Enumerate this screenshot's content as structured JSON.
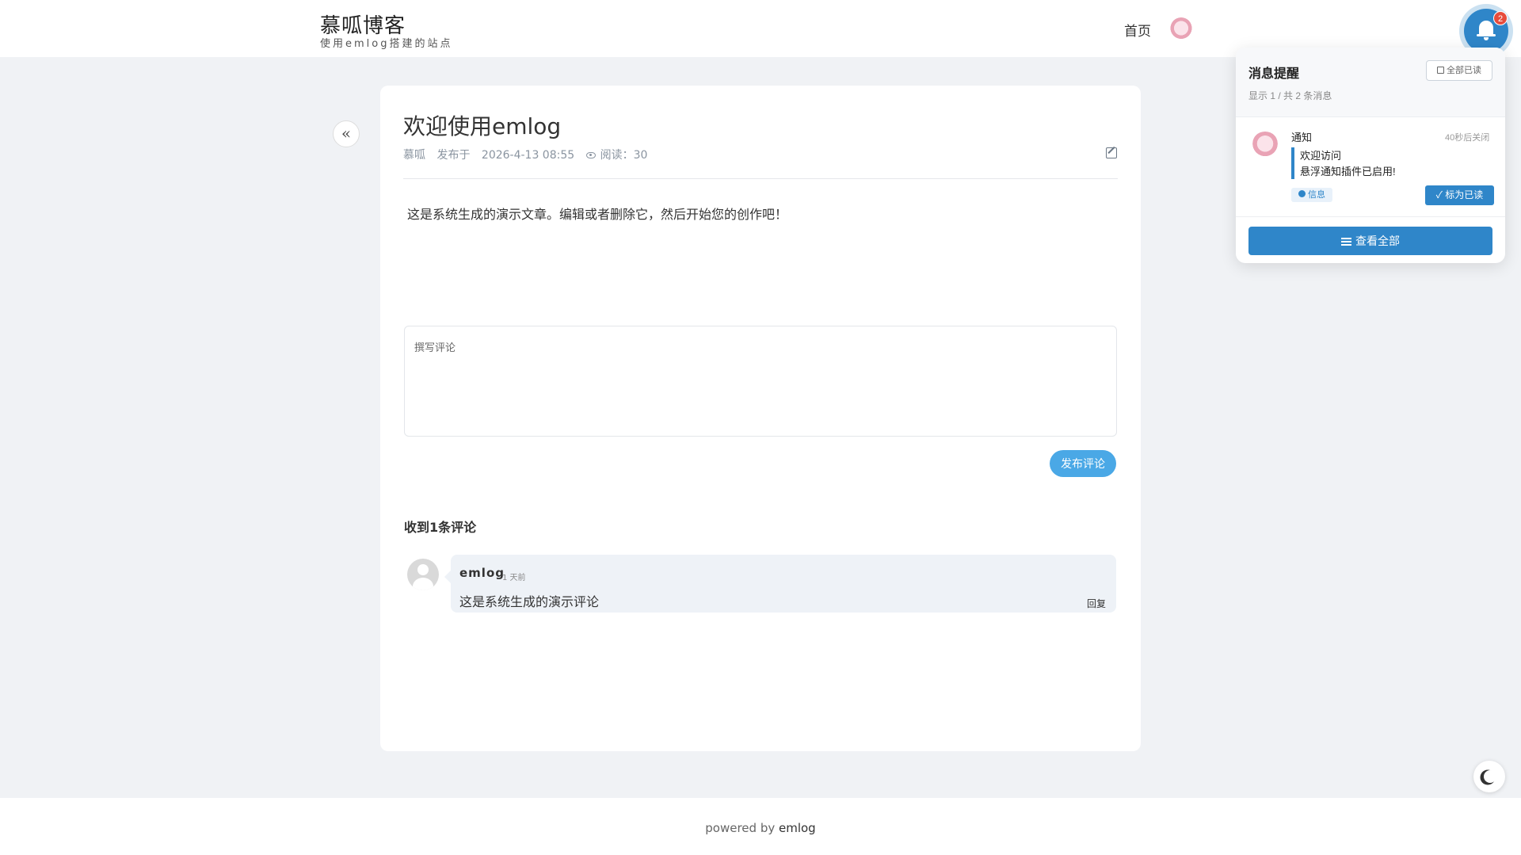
{
  "header": {
    "site_title": "慕呱博客",
    "site_subtitle": "使用emlog搭建的站点",
    "nav_home": "首页"
  },
  "post": {
    "back_glyph": "«",
    "title": "欢迎使用emlog",
    "author": "慕呱",
    "published_label": "发布于",
    "published_at": "2026-4-13 08:55",
    "views_label": "阅读：30",
    "body": "这是系统生成的演示文章。编辑或者删除它，然后开始您的创作吧！"
  },
  "comment_form": {
    "placeholder": "撰写评论",
    "submit_label": "发布评论"
  },
  "comments": {
    "heading": "收到1条评论",
    "items": [
      {
        "author": "emlog",
        "time": "1 天前",
        "text": "这是系统生成的演示评论",
        "reply_label": "回复"
      }
    ]
  },
  "footer": {
    "prefix": "powered by",
    "brand": "emlog"
  },
  "notifications": {
    "badge_count": "2",
    "title": "消息提醒",
    "mark_all_label": "全部已读",
    "count_text": "显示 1 / 共 2 条消息",
    "items": [
      {
        "type": "通知",
        "auto_close": "40秒后关闭",
        "line1": "欢迎访问",
        "line2": "悬浮通知插件已启用!",
        "tag": "信息",
        "mark_read_label": "标为已读"
      }
    ],
    "view_all_label": "查看全部"
  },
  "colors": {
    "accent": "#2f86c9",
    "submit": "#4aa8e6",
    "badge": "#e74c3c",
    "page_bg": "#f0f2f5"
  },
  "icons": [
    "bell-icon",
    "moon-icon",
    "edit-icon",
    "eye-icon",
    "list-icon",
    "check-icon",
    "info-icon"
  ]
}
